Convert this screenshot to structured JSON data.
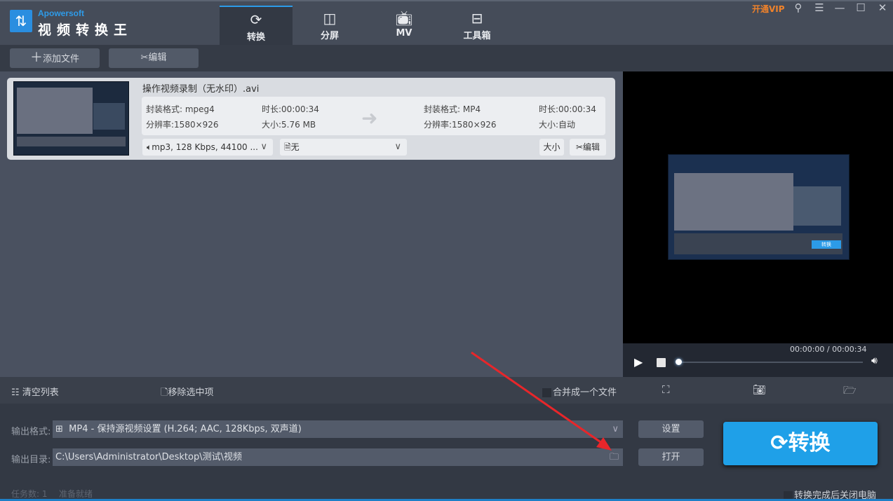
{
  "app": {
    "brand": "Apowersoft",
    "name": "视频转换王",
    "vip": "开通VIP"
  },
  "tabs": [
    {
      "label": "转换",
      "icon": "refresh-icon"
    },
    {
      "label": "分屏",
      "icon": "split-screen-icon"
    },
    {
      "label": "MV",
      "icon": "tv-icon"
    },
    {
      "label": "工具箱",
      "icon": "toolbox-icon"
    }
  ],
  "toolbar": {
    "add_file": "添加文件",
    "edit": "编辑"
  },
  "file": {
    "name": "操作视频录制（无水印）.avi",
    "source": {
      "format": "封装格式: mpeg4",
      "duration": "时长:00:00:34",
      "resolution": "分辨率:1580×926",
      "size": "大小:5.76 MB"
    },
    "target": {
      "format": "封装格式: MP4",
      "duration": "时长:00:00:34",
      "resolution": "分辨率:1580×926",
      "size": "大小:自动"
    },
    "audio": "mp3, 128 Kbps, 44100 ...",
    "subtitle": "无",
    "size_btn": "大小",
    "edit_btn": "编辑"
  },
  "player": {
    "time": "00:00:00 / 00:00:34",
    "progress": 0
  },
  "thumbnail": {
    "convert_label": "转换"
  },
  "actions": {
    "clear": "清空列表",
    "remove": "移除选中项",
    "merge": "合并成一个文件"
  },
  "output": {
    "format_label": "输出格式:",
    "format_value": "MP4 - 保持源视频设置 (H.264; AAC, 128Kbps, 双声道)",
    "dir_label": "输出目录:",
    "dir_value": "C:\\Users\\Administrator\\Desktop\\测试\\视频",
    "settings": "设置",
    "open": "打开",
    "convert": "转换"
  },
  "status": {
    "tasks": "任务数: 1",
    "state": "准备就绪",
    "shutdown": "转换完成后关闭电脑"
  }
}
